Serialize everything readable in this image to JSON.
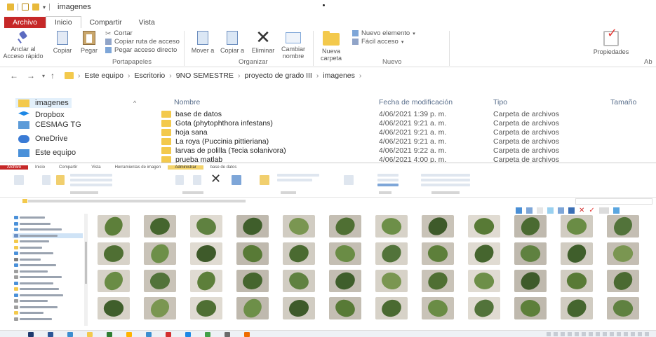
{
  "window": {
    "title": "imagenes",
    "tabs": [
      "Archivo",
      "Inicio",
      "Compartir",
      "Vista"
    ]
  },
  "ribbon": {
    "pin_label": "Anclar al Acceso rápido",
    "copy_label": "Copiar",
    "paste_label": "Pegar",
    "cut_label": "Cortar",
    "copy_path_label": "Copiar ruta de acceso",
    "paste_shortcut_label": "Pegar acceso directo",
    "clipboard_group": "Portapapeles",
    "move_label": "Mover a",
    "copy_to_label": "Copiar a",
    "delete_label": "Eliminar",
    "rename_label": "Cambiar nombre",
    "organize_group": "Organizar",
    "new_folder_label": "Nueva carpeta",
    "new_item_label": "Nuevo elemento",
    "easy_access_label": "Fácil acceso",
    "new_group": "Nuevo",
    "properties_label": "Propiedades",
    "open_group_partial": "Ab"
  },
  "address": {
    "crumbs": [
      "Este equipo",
      "Escritorio",
      "9NO SEMESTRE",
      "proyecto de grado III",
      "imagenes"
    ]
  },
  "nav_pane": {
    "items": [
      "imagenes",
      "Dropbox",
      "CESMAG TG",
      "OneDrive",
      "Este equipo"
    ]
  },
  "columns": {
    "name": "Nombre",
    "date": "Fecha de modificación",
    "type": "Tipo",
    "size": "Tamaño"
  },
  "files": [
    {
      "name": "base de datos",
      "date": "4/06/2021 1:39 p. m.",
      "type": "Carpeta de archivos"
    },
    {
      "name": "Gota (phytophthora infestans)",
      "date": "4/06/2021 9:21 a. m.",
      "type": "Carpeta de archivos"
    },
    {
      "name": "hoja sana",
      "date": "4/06/2021 9:21 a. m.",
      "type": "Carpeta de archivos"
    },
    {
      "name": "La roya (Puccinia pittieriana)",
      "date": "4/06/2021 9:21 a. m.",
      "type": "Carpeta de archivos"
    },
    {
      "name": "larvas de polilla (Tecia solanivora)",
      "date": "4/06/2021 9:22 a. m.",
      "type": "Carpeta de archivos"
    },
    {
      "name": "prueba matlab",
      "date": "4/06/2021 4:00 p. m.",
      "type": "Carpeta de archivos"
    }
  ],
  "thumbnail_window": {
    "tabs": [
      "Archivo",
      "Inicio",
      "Compartir",
      "Vista",
      "Herramientas de imagen",
      "Administrar",
      "base de datos"
    ],
    "thumbnails": {
      "rows": 4,
      "cols": 12,
      "leaf_colors": [
        "#5d7f3a",
        "#4f6f33",
        "#6a8c45",
        "#3f5e2b",
        "#587a36",
        "#45652e",
        "#6d8f48",
        "#52733a",
        "#7a9651",
        "#4a6a31",
        "#5f8140",
        "#3e5a2a"
      ]
    }
  },
  "colors": {
    "file_tab": "#c62828",
    "folder": "#f3c94c",
    "selection": "#e3f0fb",
    "header_text": "#5a6f8c"
  }
}
